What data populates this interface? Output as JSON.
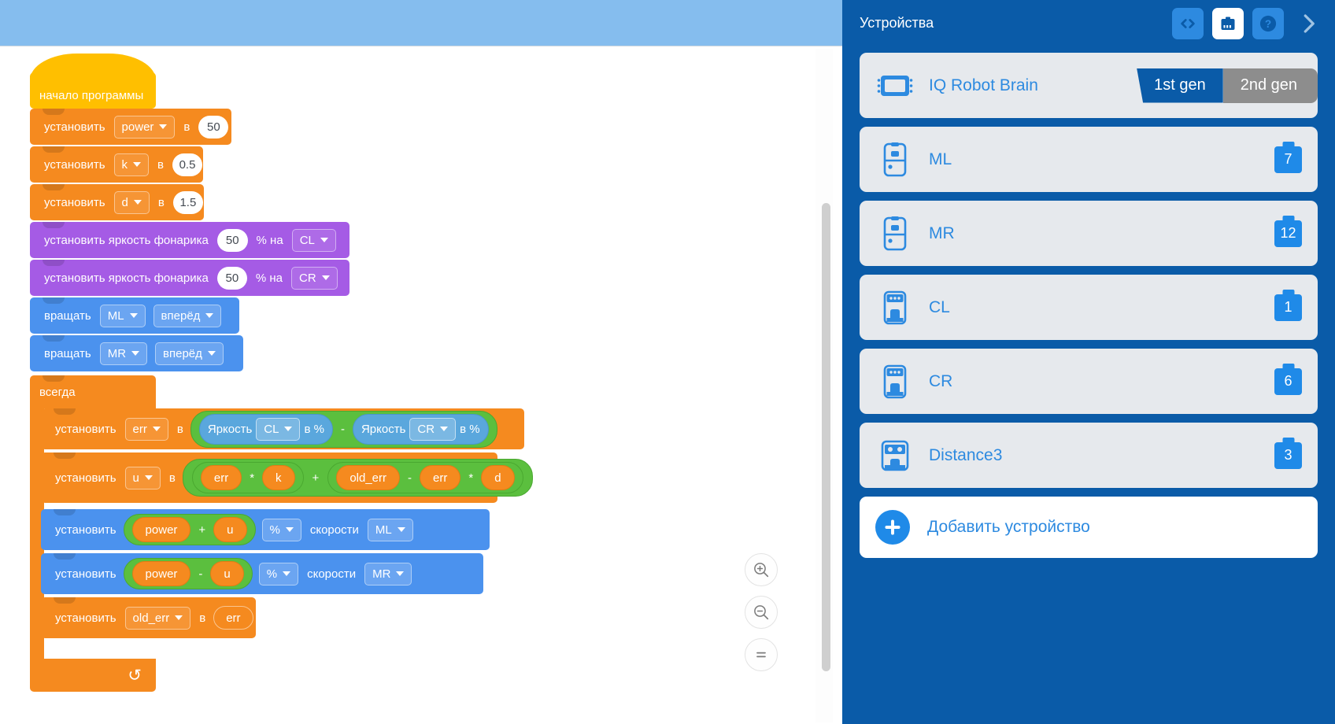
{
  "workspace": {
    "zoom_controls": [
      {
        "name": "zoom-in-button",
        "icon": "magnifier-plus-icon",
        "label": "+"
      },
      {
        "name": "zoom-out-button",
        "icon": "magnifier-minus-icon",
        "label": "−"
      },
      {
        "name": "zoom-reset-button",
        "icon": "equals-icon",
        "label": "="
      }
    ],
    "blocks": {
      "start_hat": "начало программы",
      "set_label": "установить",
      "to_label": "в",
      "set_power": {
        "variable": "power",
        "value": "50"
      },
      "set_k": {
        "variable": "k",
        "value": "0.5"
      },
      "set_d": {
        "variable": "d",
        "value": "1.5"
      },
      "flashlight_label": "установить яркость фонарика",
      "percent_on_label": "% на",
      "flashlight_cl": {
        "value": "50",
        "device": "CL"
      },
      "flashlight_cr": {
        "value": "50",
        "device": "CR"
      },
      "spin_label": "вращать",
      "spin_ml": {
        "device": "ML",
        "direction": "вперёд"
      },
      "spin_mr": {
        "device": "MR",
        "direction": "вперёд"
      },
      "forever_label": "всегда",
      "loop_arrow": "↺",
      "set_err": {
        "variable": "err",
        "brightness_label": "Яркость",
        "in_percent_label": "в %",
        "left_device": "CL",
        "right_device": "CR",
        "operator": "-"
      },
      "set_u": {
        "variable": "u",
        "term1_a": "err",
        "term1_op": "*",
        "term1_b": "k",
        "outer_op": "+",
        "term2_a": "old_err",
        "term2_op": "-",
        "term2_b": "err",
        "term2_mul_op": "*",
        "term2_c": "d"
      },
      "speed_ml": {
        "variable": "power",
        "operator": "+",
        "operand": "u",
        "unit": "%",
        "speed_label": "скорости",
        "device": "ML"
      },
      "speed_mr": {
        "variable": "power",
        "operator": "-",
        "operand": "u",
        "unit": "%",
        "speed_label": "скорости",
        "device": "MR"
      },
      "set_old_err": {
        "variable": "old_err",
        "value": "err"
      }
    }
  },
  "sidebar": {
    "title": "Устройства",
    "header_buttons": [
      {
        "name": "code-view-button",
        "icon": "code-brackets-icon",
        "label": "<>"
      },
      {
        "name": "brain-button",
        "icon": "robot-brain-icon",
        "label": ""
      },
      {
        "name": "help-button",
        "icon": "question-mark-icon",
        "label": "?"
      },
      {
        "name": "collapse-panel-button",
        "icon": "chevron-right-icon",
        "label": ">"
      }
    ],
    "brain": {
      "name": "IQ Robot Brain",
      "icon": "robot-brain-icon",
      "gen_1_label": "1st gen",
      "gen_2_label": "2nd gen",
      "selected_gen": "1st gen"
    },
    "devices": [
      {
        "name": "ML",
        "icon": "motor-icon",
        "port": "7"
      },
      {
        "name": "MR",
        "icon": "motor-icon",
        "port": "12"
      },
      {
        "name": "CL",
        "icon": "color-sensor-icon",
        "port": "1"
      },
      {
        "name": "CR",
        "icon": "color-sensor-icon",
        "port": "6"
      },
      {
        "name": "Distance3",
        "icon": "distance-sensor-icon",
        "port": "3"
      }
    ],
    "add_device": {
      "label": "Добавить устройство",
      "icon": "plus-circle-icon"
    }
  },
  "colors": {
    "accent_blue": "#0a5ba8",
    "light_blue": "#2d8ae0",
    "toolbar_blue": "#85bdee",
    "block_orange": "#f58a1f",
    "block_yellow": "#ffbf00",
    "block_purple": "#a55be5",
    "block_blue": "#4b92ee",
    "block_green": "#5bbf3e",
    "sensor_blue": "#5aa7dd"
  }
}
